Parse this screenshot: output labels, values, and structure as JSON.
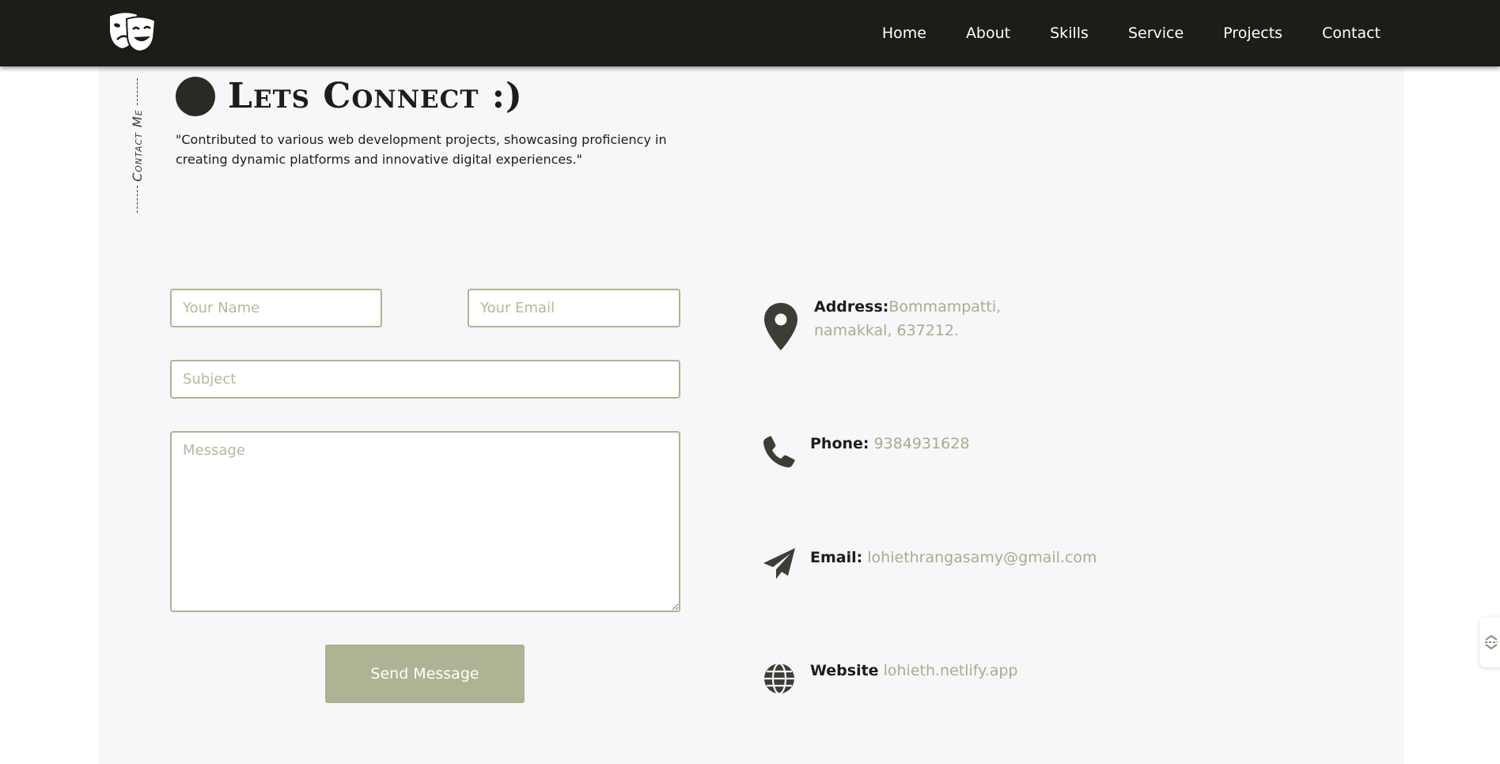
{
  "nav": {
    "logo_icon": "theatre-masks-icon",
    "links": [
      "Home",
      "About",
      "Skills",
      "Service",
      "Projects",
      "Contact"
    ]
  },
  "section": {
    "vertical_label": "Contact Me",
    "title": "Lets Connect :)",
    "quote": "\"Contributed to various web development projects, showcasing proficiency in creating dynamic platforms and innovative digital experiences.\""
  },
  "form": {
    "name_placeholder": "Your Name",
    "email_placeholder": "Your Email",
    "subject_placeholder": "Subject",
    "message_placeholder": "Message",
    "name_value": "",
    "email_value": "",
    "subject_value": "",
    "message_value": "",
    "send_label": "Send Message"
  },
  "info": {
    "address_label": "Address:",
    "address_value_line1": "Bommampatti,",
    "address_value_line2": "namakkal, 637212.",
    "address_icon": "map-pin-icon",
    "phone_label": "Phone:",
    "phone_value": "9384931628",
    "phone_icon": "phone-icon",
    "email_label": "Email:",
    "email_value": "lohiethrangasamy@gmail.com",
    "email_icon": "paper-plane-icon",
    "website_label": "Website",
    "website_value": "lohieth.netlify.app",
    "website_icon": "globe-icon"
  },
  "colors": {
    "navbar_bg": "#1c1c18",
    "accent": "#aeb393",
    "accent_text": "#a8ad8c",
    "content_bg": "#f6f7f9",
    "dark_icon": "#3d3d35"
  }
}
